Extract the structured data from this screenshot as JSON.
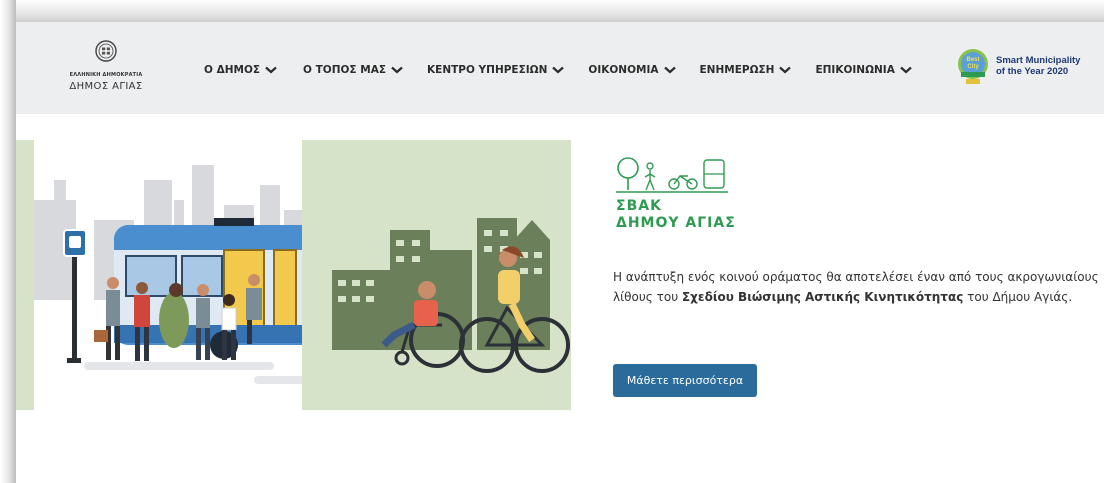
{
  "header": {
    "logo_top": "ΕΛΛΗΝΙΚΗ ΔΗΜΟΚΡΑΤΙΑ",
    "logo_name": "ΔΗΜΟΣ ΑΓΙΑΣ",
    "nav": [
      "Ο ΔΗΜΟΣ",
      "Ο ΤΟΠΟΣ ΜΑΣ",
      "ΚΕΝΤΡΟ ΥΠΗΡΕΣΙΩΝ",
      "ΟΙΚΟΝΟΜΙΑ",
      "ΕΝΗΜΕΡΩΣΗ",
      "ΕΠΙΚΟΙΝΩΝΙΑ"
    ],
    "award_line1": "Smart Municipality",
    "award_line2": "of the Year 2020",
    "award_badge": "Best City"
  },
  "sbak": {
    "line1": "ΣΒΑΚ",
    "line2": "ΔΗΜΟΥ ΑΓΙΑΣ"
  },
  "intro": {
    "part1": "Η ανάπτυξη ενός κοινού οράματος θα αποτελέσει έναν από τους ακρογωνιαίους λίθους του ",
    "bold": "Σχεδίου Βιώσιμης Αστικής Κινητικότητας",
    "part2": " του Δήμου Αγιάς."
  },
  "cta_label": "Μάθετε περισσότερα",
  "colors": {
    "header_bg": "#eceef0",
    "green": "#2f9a52",
    "cta": "#2a6b9c",
    "illus_green": "#d6e3c9"
  }
}
